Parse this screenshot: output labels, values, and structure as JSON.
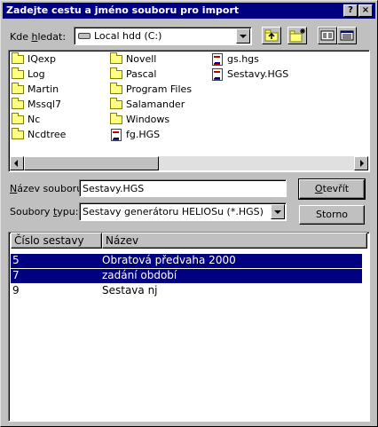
{
  "window": {
    "title": "Zadejte cestu a jméno souboru pro import",
    "help_glyph": "?",
    "close_glyph": "×"
  },
  "location": {
    "label_prefix": "Kde ",
    "label_accel": "h",
    "label_rest": "ledat:",
    "value": "Local hdd (C:)",
    "icon": "drive-icon"
  },
  "toolbar": {
    "up_icon": "up-folder-icon",
    "new_folder_icon": "new-folder-icon",
    "list_view_icon": "list-view-icon",
    "details_view_icon": "details-view-icon"
  },
  "files": [
    {
      "name": "IQexp",
      "icon": "folder-icon"
    },
    {
      "name": "Log",
      "icon": "folder-icon"
    },
    {
      "name": "Martin",
      "icon": "folder-icon"
    },
    {
      "name": "Mssql7",
      "icon": "folder-icon"
    },
    {
      "name": "Nc",
      "icon": "folder-icon"
    },
    {
      "name": "Ncdtree",
      "icon": "folder-icon"
    },
    {
      "name": "Novell",
      "icon": "folder-icon"
    },
    {
      "name": "Pascal",
      "icon": "folder-icon"
    },
    {
      "name": "Program Files",
      "icon": "folder-icon"
    },
    {
      "name": "Salamander",
      "icon": "folder-icon"
    },
    {
      "name": "Windows",
      "icon": "folder-icon"
    },
    {
      "name": "fg.HGS",
      "icon": "hgs-file-icon"
    },
    {
      "name": "gs.hgs",
      "icon": "hgs-file-icon"
    },
    {
      "name": "Sestavy.HGS",
      "icon": "hgs-file-icon"
    }
  ],
  "filename": {
    "label_accel": "N",
    "label_rest": "ázev souboru:",
    "value": "Sestavy.HGS"
  },
  "filetype": {
    "label_prefix": "Soubory ",
    "label_accel": "t",
    "label_rest": "ypu:",
    "value": "Sestavy generátoru HELIOSu (*.HGS)"
  },
  "buttons": {
    "open_accel": "O",
    "open_rest": "tevřít",
    "cancel": "Storno"
  },
  "report_table": {
    "columns": [
      "Číslo sestavy",
      "Název"
    ],
    "rows": [
      {
        "number": "5",
        "name": "Obratová předvaha 2000",
        "selected": true
      },
      {
        "number": "7",
        "name": "zadání období",
        "selected": true
      },
      {
        "number": "9",
        "name": "Sestava nj",
        "selected": false
      }
    ]
  },
  "colors": {
    "face": "#c0c0c0",
    "title_bar": "#000080",
    "selection": "#000080"
  }
}
